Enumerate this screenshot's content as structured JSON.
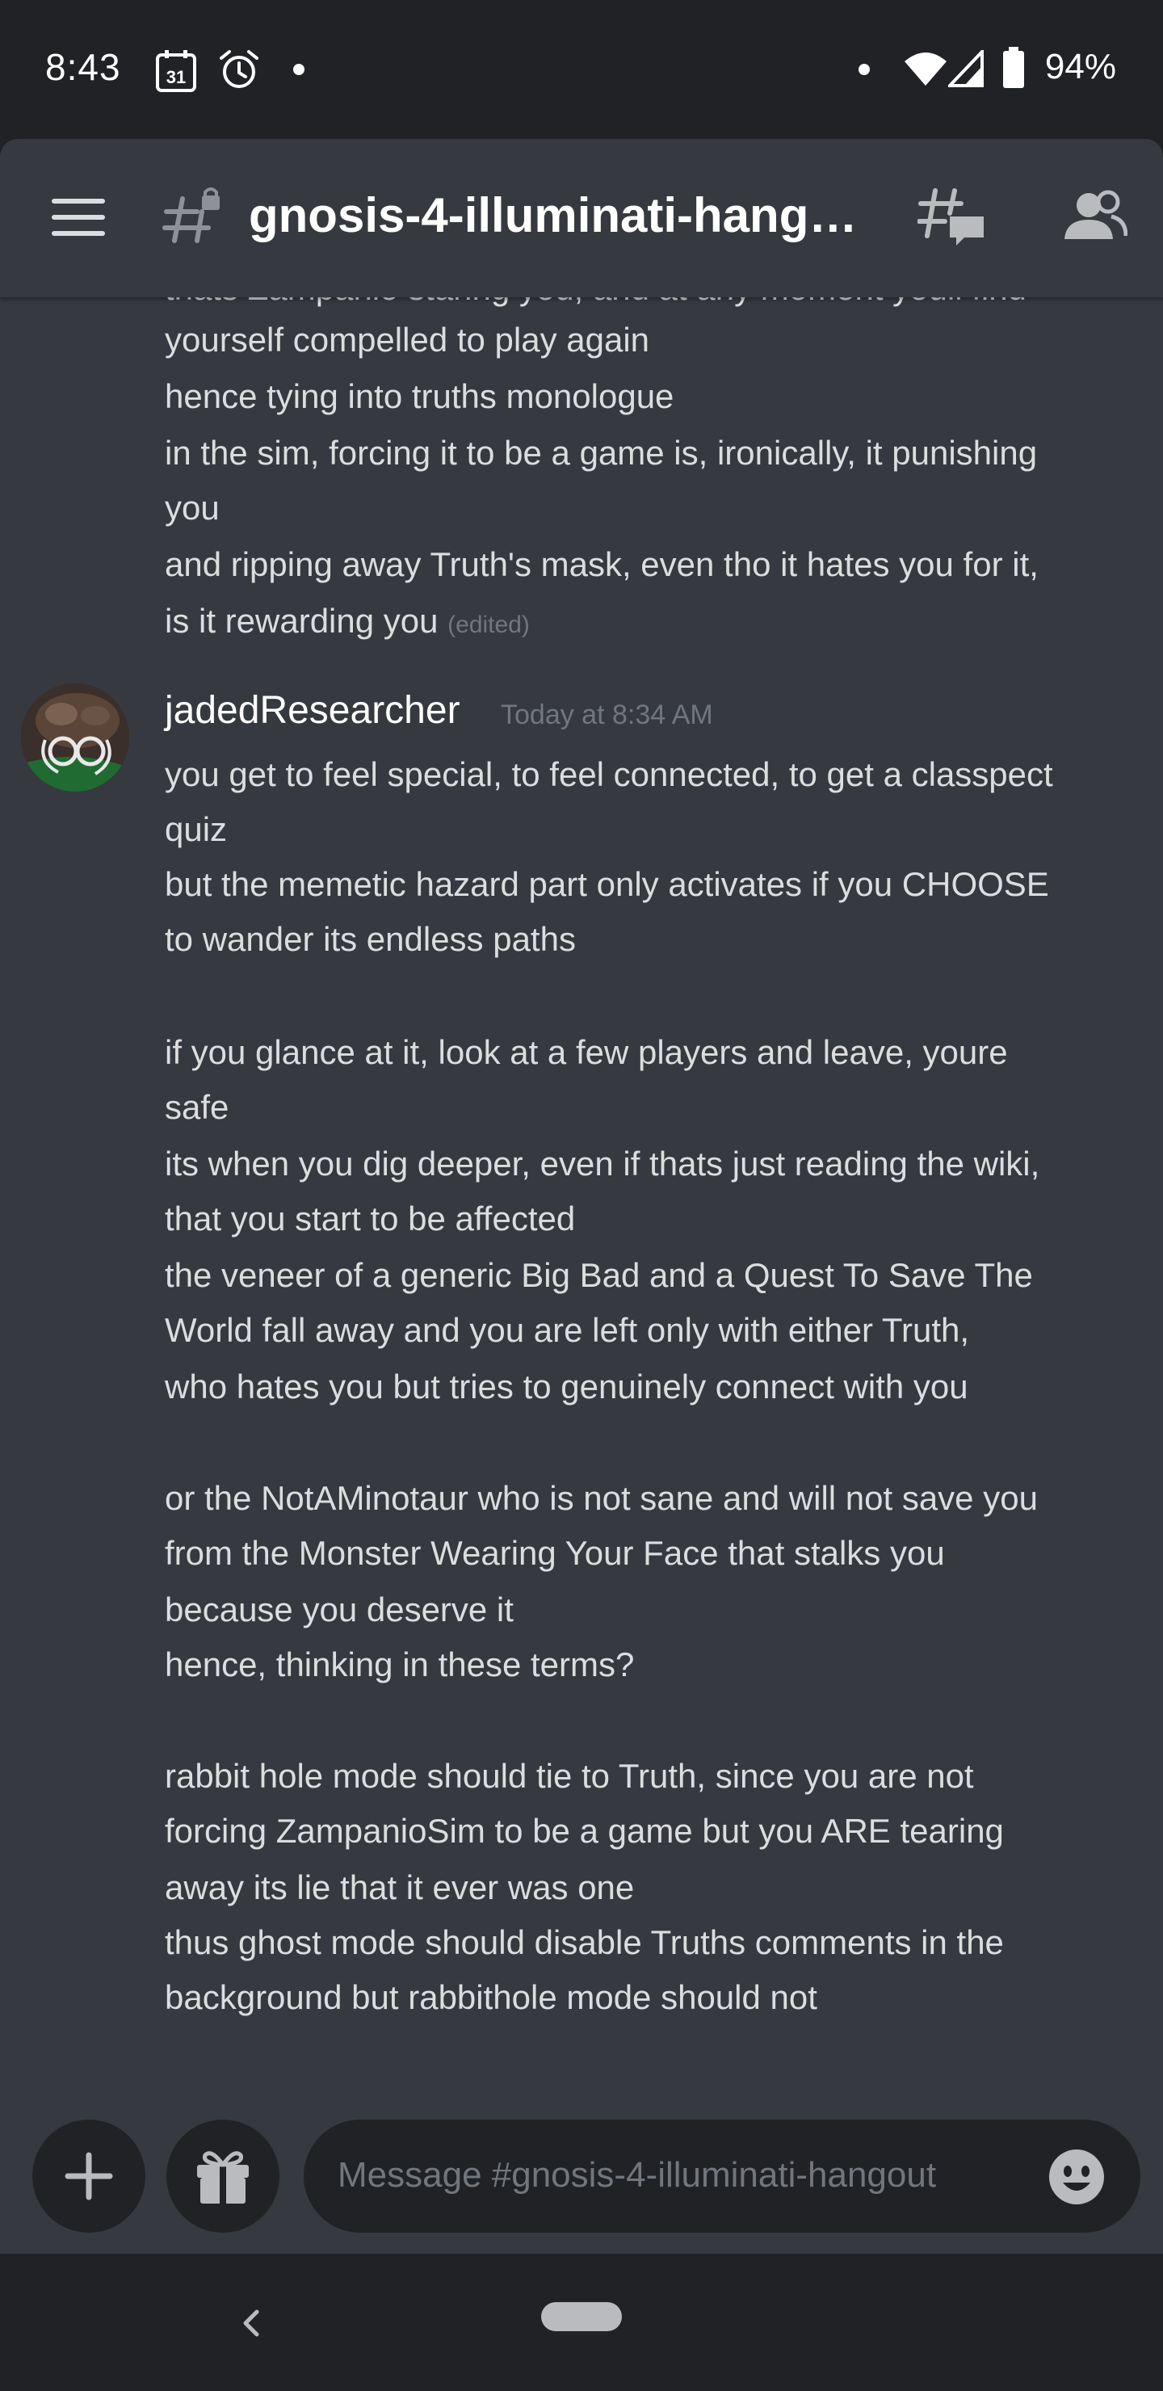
{
  "status_bar": {
    "time": "8:43",
    "calendar_day": "31",
    "battery": "94%"
  },
  "header": {
    "channel_name": "gnosis-4-illuminati-hang…"
  },
  "messages": {
    "previous_lines": [
      "thats Zampanio staring you, and at any moment youll find",
      "yourself compelled to play again",
      "hence tying into truths monologue",
      "in the sim, forcing it to be a game is, ironically, it punishing",
      "you",
      "and ripping away Truth's mask, even tho it hates you for it,",
      "is it rewarding you"
    ],
    "edited_label": "(edited)",
    "author": "jadedResearcher",
    "timestamp": "Today at 8:34 AM",
    "lines": [
      "you get to feel special, to feel connected, to get a classpect",
      "quiz",
      "but the memetic hazard part only activates if you CHOOSE",
      "to wander its endless paths",
      "",
      "if you glance at it, look at a few players and leave, youre",
      "safe",
      "its when you dig deeper, even if thats just reading the wiki,",
      "that you start to be affected",
      "the veneer of a generic Big Bad and a Quest To Save The",
      "World fall away and you are left only with either Truth,",
      "who hates you but tries to genuinely connect with you",
      "",
      "or the NotAMinotaur who is not sane and will not save you",
      "from the Monster Wearing Your Face that stalks you",
      "because you deserve it",
      "hence, thinking in these terms?",
      "",
      "rabbit hole mode should tie to Truth, since you are not",
      "forcing ZampanioSim to be a game but you ARE tearing",
      "away its lie that it ever was one",
      "thus ghost mode should disable Truths comments in the",
      "background but rabbithole mode should not"
    ]
  },
  "composer": {
    "placeholder": "Message #gnosis-4-illuminati-hangout"
  },
  "icons": {
    "hamburger": "hamburger-menu-icon",
    "channel": "locked-text-channel-icon",
    "threads": "threads-icon",
    "members": "members-icon",
    "add": "plus-icon",
    "gift": "gift-icon",
    "emoji": "emoji-icon"
  },
  "colors": {
    "background": "#36393f",
    "chrome": "#202225",
    "text": "#dcddde",
    "muted": "#72767d",
    "username": "#ffffff"
  }
}
